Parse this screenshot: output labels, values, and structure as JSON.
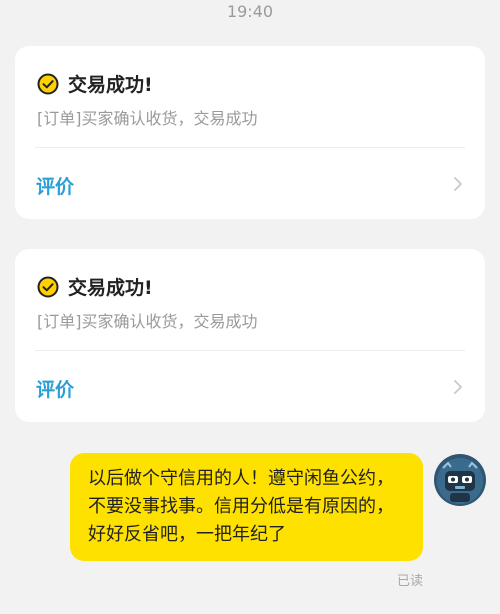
{
  "chat": {
    "timestamp": "19:40",
    "cards": [
      {
        "title": "交易成功!",
        "subtitle": "[订单]买家确认收货，交易成功",
        "action_label": "评价",
        "icon": "check-circle-icon",
        "action_icon": "chevron-right-icon"
      },
      {
        "title": "交易成功!",
        "subtitle": "[订单]买家确认收货，交易成功",
        "action_label": "评价",
        "icon": "check-circle-icon",
        "action_icon": "chevron-right-icon"
      }
    ],
    "outgoing_message": {
      "text": "以后做个守信用的人！遵守闲鱼公约，不要没事找事。信用分低是有原因的，好好反省吧，一把年纪了",
      "status": "已读"
    }
  },
  "colors": {
    "background": "#f2f2f2",
    "card": "#ffffff",
    "accent_blue": "#2a9fd6",
    "bubble_yellow": "#ffe100",
    "check_yellow": "#ffd100"
  }
}
